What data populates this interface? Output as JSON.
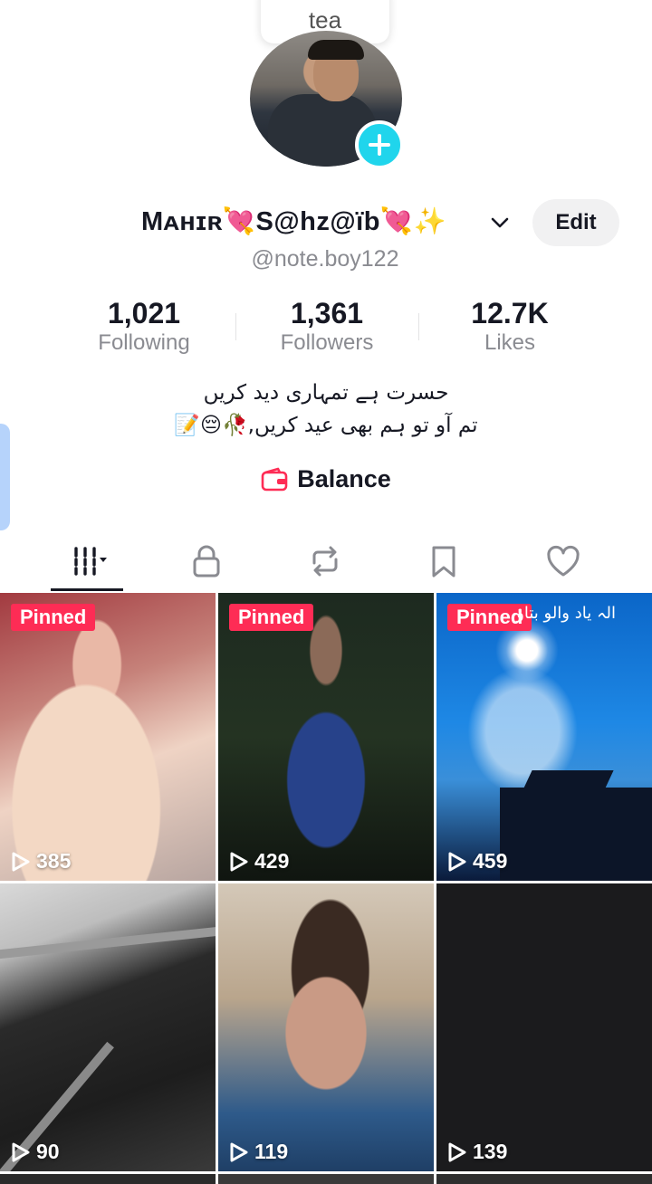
{
  "profile": {
    "note": "tea",
    "display_name": "Mᴀʜɪʀ💘S@hz@ïb💘✨",
    "username": "@note.boy122",
    "edit_label": "Edit",
    "bio_line_1": "حسرت ہے تمہاری دید کریں",
    "bio_line_2": "تم آو تو ہم بھی عید کریں,🥀😔📝",
    "balance_label": "Balance"
  },
  "stats": [
    {
      "value": "1,021",
      "label": "Following"
    },
    {
      "value": "1,361",
      "label": "Followers"
    },
    {
      "value": "12.7K",
      "label": "Likes"
    }
  ],
  "tabs": [
    {
      "icon": "grid-icon",
      "active": true
    },
    {
      "icon": "lock-icon"
    },
    {
      "icon": "repost-icon"
    },
    {
      "icon": "bookmark-icon"
    },
    {
      "icon": "heart-icon"
    }
  ],
  "videos": [
    {
      "pinned": "Pinned",
      "views": "385"
    },
    {
      "pinned": "Pinned",
      "views": "429"
    },
    {
      "pinned": "Pinned",
      "views": "459",
      "overlay_text": "الہ یاد والو بتاؤ"
    },
    {
      "views": "90"
    },
    {
      "views": "119"
    },
    {
      "views": "139"
    }
  ],
  "colors": {
    "accent": "#fe2c55",
    "add_button": "#20d5ec",
    "muted_text": "#8a8b91"
  }
}
